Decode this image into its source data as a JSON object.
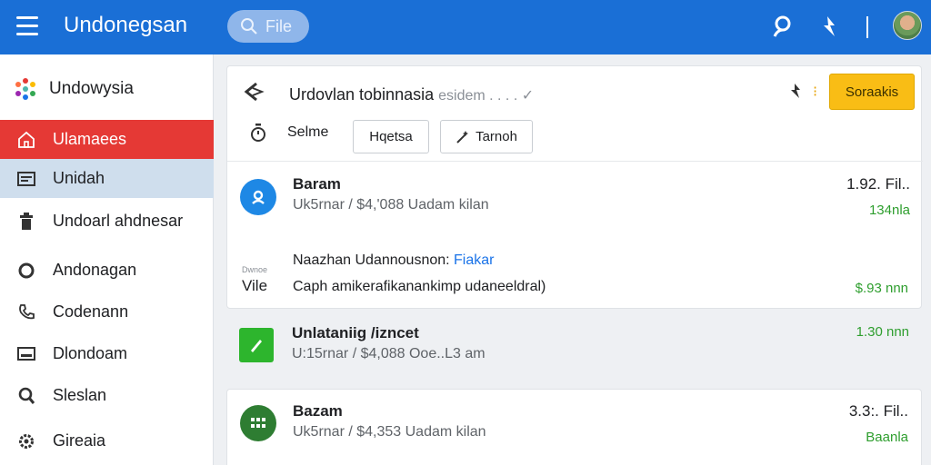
{
  "header": {
    "title": "Undonegsan",
    "search_placeholder": "File",
    "icons": [
      "menu-icon",
      "search-icon",
      "person-icon",
      "bolt-icon",
      "avatar"
    ]
  },
  "sidebar": {
    "brand": "Undowysia",
    "items": [
      {
        "label": "Ulamaees",
        "icon": "home-icon",
        "state": "active-red"
      },
      {
        "label": "Unidah",
        "icon": "inbox-icon",
        "state": "active-blue"
      },
      {
        "label": "Undoarl ahdnesar",
        "icon": "trash-icon",
        "state": ""
      },
      {
        "label": "Andonagan",
        "icon": "circle-icon",
        "state": ""
      },
      {
        "label": "Codenann",
        "icon": "phone-icon",
        "state": ""
      },
      {
        "label": "Dlondoam",
        "icon": "screen-icon",
        "state": ""
      },
      {
        "label": "Sleslan",
        "icon": "search-icon",
        "state": ""
      },
      {
        "label": "Gireaia",
        "icon": "gear-icon",
        "state": ""
      }
    ]
  },
  "panel": {
    "title": "Urdovlan tobinnasia",
    "title_muted": "esidem . . . . ✓",
    "primary_button": "Soraakis",
    "sort_label": "Selme",
    "chip1": "Hqetsa",
    "chip2": "Tarnoh"
  },
  "items": [
    {
      "title": "Baram",
      "sub": "Uk5rnar / $4,'088 Uadam kilan",
      "size": "1.92. Fil..",
      "extra": "134nla"
    },
    {
      "title": "Unlataniig /izncet",
      "sub": "U:15rnar / $4,088 Ooe..L3 am",
      "size": "1.30 nnn",
      "extra": ""
    },
    {
      "title": "Bazam",
      "sub": "Uk5rnar / $4,353 Uadam kilan",
      "size": "3.3:. Fil..",
      "extra": "Baanla"
    }
  ],
  "notice": {
    "thumb_small": "Dwnoe",
    "thumb_label": "Vile",
    "line1": "Naazhan Udannousnon:",
    "line1_link": "Fiakar",
    "line2": "Caph amikerafikanankimp udaneeldral)",
    "amount": "$.93 nnn"
  },
  "colors": {
    "topbar": "#1a6fd6",
    "active_red": "#e53935",
    "active_blue": "#cfdeed",
    "accent_yellow": "#f9bd15",
    "green_text": "#2e9e2e"
  }
}
